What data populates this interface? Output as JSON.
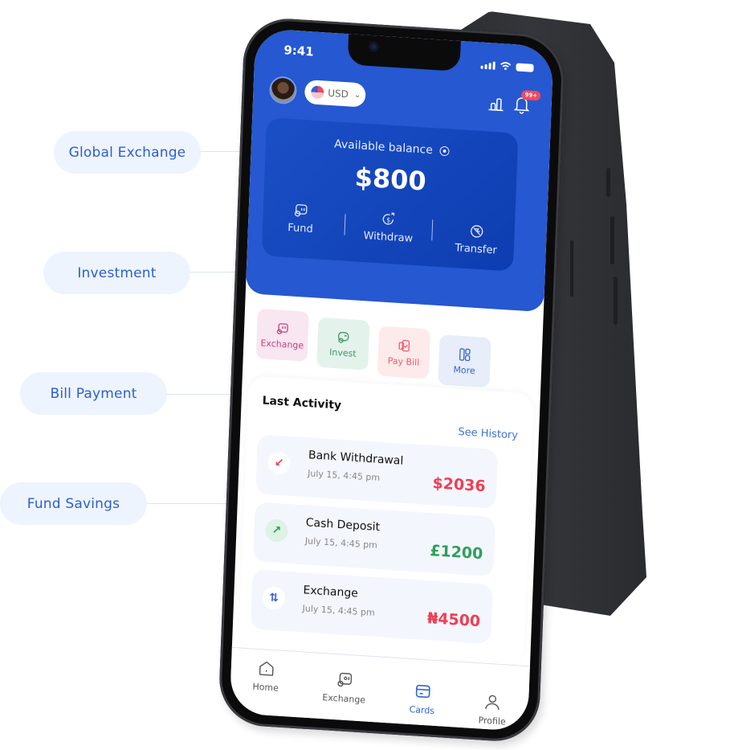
{
  "callouts": [
    {
      "label": "Global Exchange"
    },
    {
      "label": "Investment"
    },
    {
      "label": "Bill Payment"
    },
    {
      "label": "Fund Savings"
    }
  ],
  "status_bar": {
    "time": "9:41"
  },
  "header": {
    "currency": "USD",
    "notification_badge": "99+"
  },
  "balance_card": {
    "label": "Available balance",
    "amount": "$800",
    "actions": [
      {
        "label": "Fund",
        "icon": "fund-icon"
      },
      {
        "label": "Withdraw",
        "icon": "withdraw-icon"
      },
      {
        "label": "Transfer",
        "icon": "transfer-icon"
      }
    ]
  },
  "quick_actions": [
    {
      "label": "Exchange",
      "icon": "exchange-icon",
      "color": "#c2407e",
      "bg": "#f8e6f0"
    },
    {
      "label": "Invest",
      "icon": "invest-icon",
      "color": "#3d9a62",
      "bg": "#e4f2ec"
    },
    {
      "label": "Pay Bill",
      "icon": "bill-icon",
      "color": "#ef5b68",
      "bg": "#fdeaea"
    },
    {
      "label": "More",
      "icon": "grid-icon",
      "color": "#3565cf",
      "bg": "#e7edf9"
    }
  ],
  "activity": {
    "title": "Last Activity",
    "see_history": "See History",
    "transactions": [
      {
        "name": "Bank Withdrawal",
        "date": "July 15, 4:45 pm",
        "amount": "$2036",
        "type": "withdrawal",
        "amount_color": "#ef3f54"
      },
      {
        "name": "Cash Deposit",
        "date": "July 15, 4:45 pm",
        "amount": "£1200",
        "type": "deposit",
        "amount_color": "#2ea05a"
      },
      {
        "name": "Exchange",
        "date": "July 15, 4:45 pm",
        "amount": "₦4500",
        "type": "exchange",
        "amount_color": "#ef3f54"
      }
    ]
  },
  "bottom_nav": [
    {
      "label": "Home",
      "icon": "home-icon",
      "active": false
    },
    {
      "label": "Exchange",
      "icon": "exchange-icon",
      "active": false
    },
    {
      "label": "Cards",
      "icon": "card-icon",
      "active": true
    },
    {
      "label": "Profile",
      "icon": "profile-icon",
      "active": false
    }
  ],
  "colors": {
    "primary_blue": "#2558d1",
    "card_blue": "#0d3db0",
    "callout_bg": "#eef4fd",
    "callout_text": "#2b5fd0"
  }
}
